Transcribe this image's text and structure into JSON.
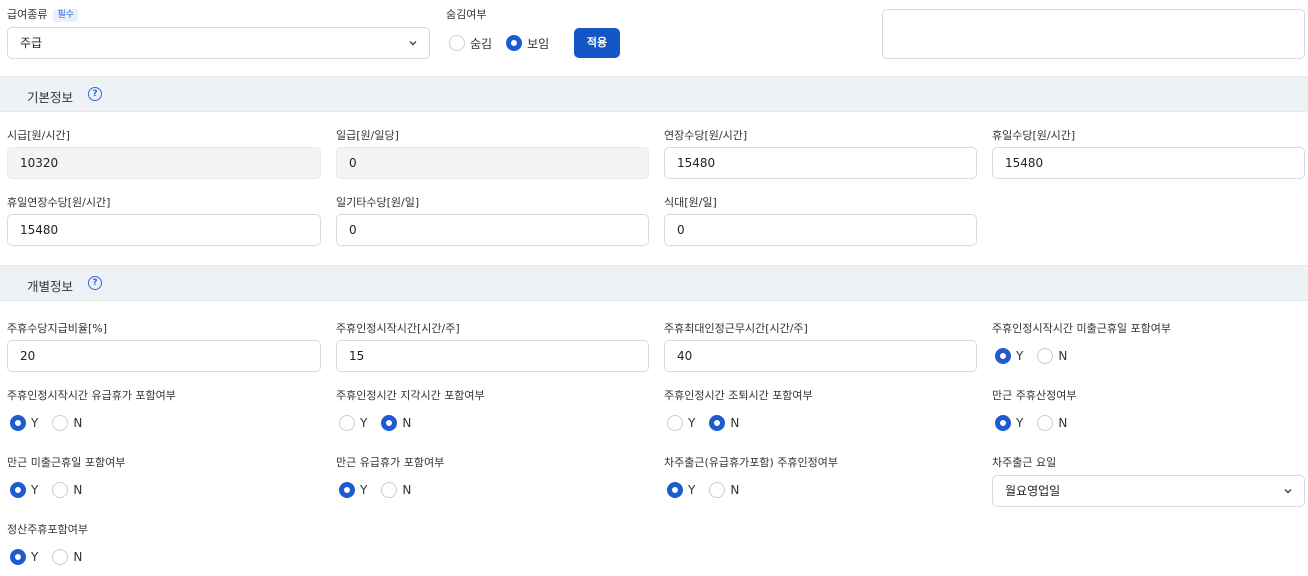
{
  "top": {
    "pay_type_label": "급여종류",
    "required_badge": "필수",
    "pay_type_value": "주급",
    "hide_label": "숨김여부",
    "hide_options": [
      "숨김",
      "보임"
    ],
    "hide_selected": 1,
    "apply_button": "적용",
    "memo_value": ""
  },
  "basic": {
    "title": "기본정보",
    "fields": [
      {
        "label": "시급[원/시간]",
        "value": "10320"
      },
      {
        "label": "일급[원/일당]",
        "value": "0"
      },
      {
        "label": "연장수당[원/시간]",
        "value": "15480"
      },
      {
        "label": "휴일수당[원/시간]",
        "value": "15480"
      },
      {
        "label": "휴일연장수당[원/시간]",
        "value": "15480"
      },
      {
        "label": "일기타수당[원/일]",
        "value": "0"
      },
      {
        "label": "식대[원/일]",
        "value": "0"
      }
    ]
  },
  "individual": {
    "title": "개별정보",
    "inputs": [
      {
        "label": "주휴수당지급비율[%]",
        "value": "20"
      },
      {
        "label": "주휴인정시작시간[시간/주]",
        "value": "15"
      },
      {
        "label": "주휴최대인정근무시간[시간/주]",
        "value": "40"
      }
    ],
    "radios": [
      {
        "label": "주휴인정시작시간 미출근휴일 포함여부",
        "selected": "Y"
      },
      {
        "label": "주휴인정시작시간 유급휴가 포함여부",
        "selected": "Y"
      },
      {
        "label": "주휴인정시간 지각시간 포함여부",
        "selected": "N"
      },
      {
        "label": "주휴인정시간 조퇴시간 포함여부",
        "selected": "N"
      },
      {
        "label": "만근 주휴산정여부",
        "selected": "Y"
      },
      {
        "label": "만근 미출근휴일 포함여부",
        "selected": "Y"
      },
      {
        "label": "만근 유급휴가 포함여부",
        "selected": "Y"
      },
      {
        "label": "차주출근(유급휴가포함) 주휴인정여부",
        "selected": "Y"
      },
      {
        "label": "정산주휴포함여부",
        "selected": "Y"
      }
    ],
    "yn": [
      "Y",
      "N"
    ],
    "next_week_day_label": "차주출근 요일",
    "next_week_day_value": "월요영업일"
  },
  "colors": {
    "accent": "#1e5bd1",
    "button": "#1455c8",
    "section_bg": "#eef1f6"
  }
}
